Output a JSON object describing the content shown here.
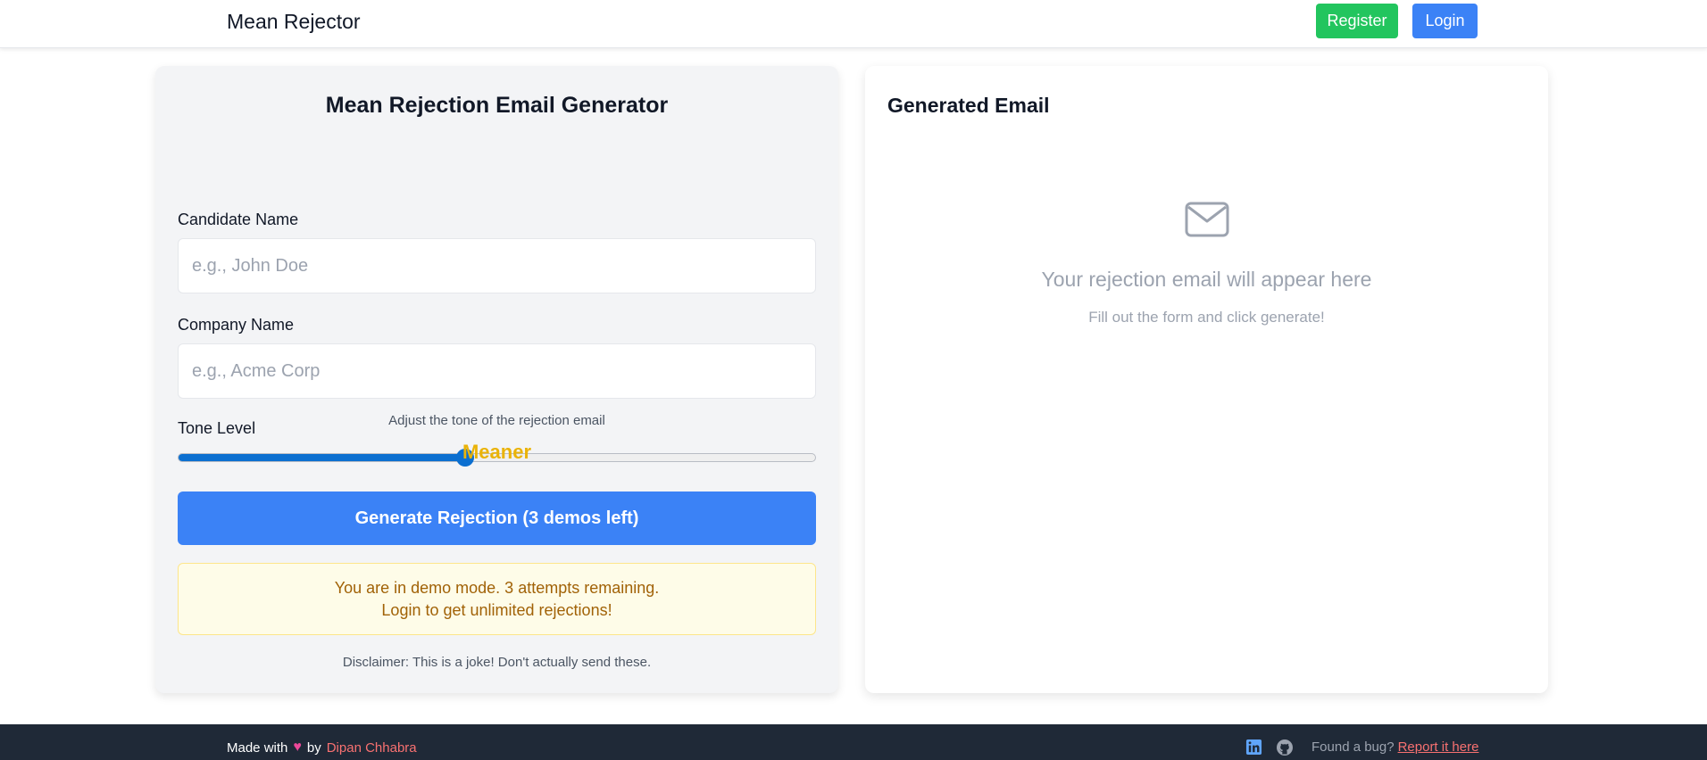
{
  "header": {
    "brand": "Mean Rejector",
    "register_label": "Register",
    "login_label": "Login"
  },
  "form": {
    "title": "Mean Rejection Email Generator",
    "candidate_label": "Candidate Name",
    "candidate_placeholder": "e.g., John Doe",
    "candidate_value": "",
    "company_label": "Company Name",
    "company_placeholder": "e.g., Acme Corp",
    "company_value": "",
    "tone_label": "Tone Level",
    "tone_fraction": 0.45,
    "tone_help": "Adjust the tone of the rejection email",
    "tone_value": "Meaner",
    "generate_label": "Generate Rejection (3 demos left)",
    "demo_line1": "You are in demo mode. 3 attempts remaining.",
    "demo_line2": "Login to get unlimited rejections!",
    "disclaimer": "Disclaimer: This is a joke! Don't actually send these."
  },
  "output": {
    "title": "Generated Email",
    "icon": "envelope-icon",
    "empty_heading": "Your rejection email will appear here",
    "empty_sub": "Fill out the form and click generate!"
  },
  "footer": {
    "made_with": "Made with",
    "heart_icon": "heart-icon",
    "by": "by",
    "author": "Dipan Chhabra",
    "bug_text": "Found a bug?",
    "report_link": "Report it here",
    "icons": [
      "linkedin-icon",
      "github-icon"
    ]
  },
  "colors": {
    "accent_blue": "#3b82f6",
    "register_green": "#22c55e",
    "tone_yellow": "#eab308",
    "footer_bg": "#1f2937",
    "link_red": "#f87171"
  }
}
